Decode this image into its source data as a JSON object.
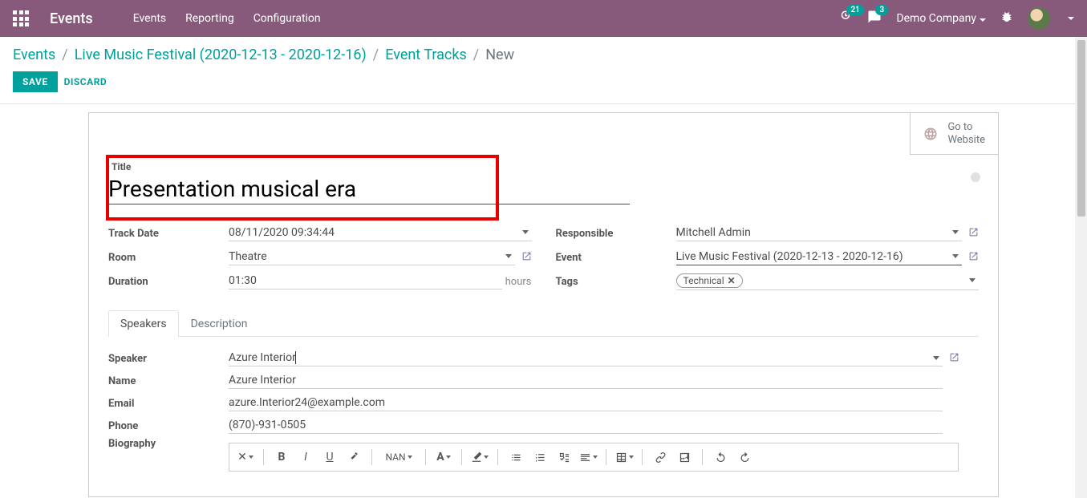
{
  "topbar": {
    "brand": "Events",
    "menu": [
      "Events",
      "Reporting",
      "Configuration"
    ],
    "activity_count": "21",
    "message_count": "3",
    "company": "Demo Company"
  },
  "breadcrumb": {
    "items": [
      "Events",
      "Live Music Festival (2020-12-13 - 2020-12-16)",
      "Event Tracks"
    ],
    "current": "New"
  },
  "actions": {
    "save": "SAVE",
    "discard": "DISCARD"
  },
  "go_website": {
    "line1": "Go to",
    "line2": "Website"
  },
  "title": {
    "label": "Title",
    "value": "Presentation musical era"
  },
  "left_fields": {
    "track_date": {
      "label": "Track Date",
      "value": "08/11/2020 09:34:44"
    },
    "room": {
      "label": "Room",
      "value": "Theatre"
    },
    "duration": {
      "label": "Duration",
      "value": "01:30",
      "suffix": "hours"
    }
  },
  "right_fields": {
    "responsible": {
      "label": "Responsible",
      "value": "Mitchell Admin"
    },
    "event": {
      "label": "Event",
      "value": "Live Music Festival (2020-12-13 - 2020-12-16)"
    },
    "tags": {
      "label": "Tags",
      "value": "Technical"
    }
  },
  "tabs": {
    "speakers": "Speakers",
    "description": "Description"
  },
  "speaker": {
    "speaker": {
      "label": "Speaker",
      "value": "Azure Interior"
    },
    "name": {
      "label": "Name",
      "value": "Azure Interior"
    },
    "email": {
      "label": "Email",
      "value": "azure.Interior24@example.com"
    },
    "phone": {
      "label": "Phone",
      "value": "(870)-931-0505"
    },
    "bio": {
      "label": "Biography"
    }
  },
  "rte": {
    "font_size": "NAN"
  }
}
